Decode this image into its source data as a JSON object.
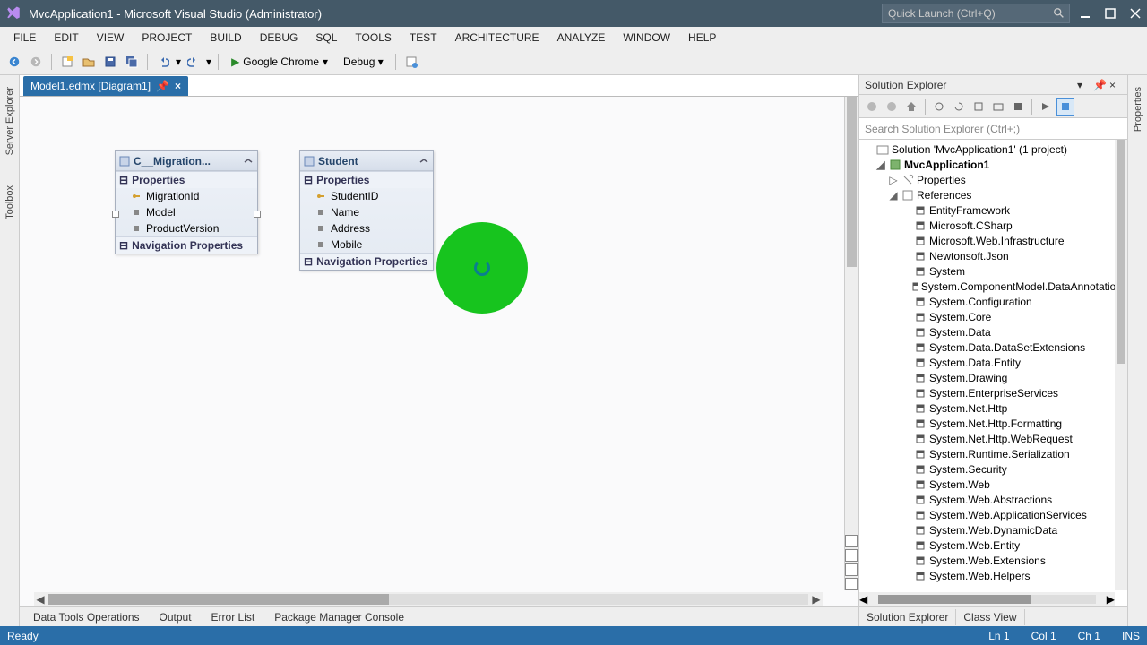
{
  "title": "MvcApplication1 - Microsoft Visual Studio (Administrator)",
  "quickLaunch": {
    "placeholder": "Quick Launch (Ctrl+Q)"
  },
  "menu": [
    "FILE",
    "EDIT",
    "VIEW",
    "PROJECT",
    "BUILD",
    "DEBUG",
    "SQL",
    "TOOLS",
    "TEST",
    "ARCHITECTURE",
    "ANALYZE",
    "WINDOW",
    "HELP"
  ],
  "toolbar": {
    "browser": "Google Chrome",
    "config": "Debug"
  },
  "leftVTabs": [
    "Server Explorer",
    "Toolbox"
  ],
  "rightVTabs": [
    "Properties"
  ],
  "docTab": {
    "label": "Model1.edmx [Diagram1]"
  },
  "entities": [
    {
      "name": "C__Migration...",
      "propsHeader": "Properties",
      "navHeader": "Navigation Properties",
      "props": [
        "MigrationId",
        "Model",
        "ProductVersion"
      ]
    },
    {
      "name": "Student",
      "propsHeader": "Properties",
      "navHeader": "Navigation Properties",
      "props": [
        "StudentID",
        "Name",
        "Address",
        "Mobile"
      ]
    }
  ],
  "bottomTabs": [
    "Data Tools Operations",
    "Output",
    "Error List",
    "Package Manager Console"
  ],
  "solExplorer": {
    "title": "Solution Explorer",
    "searchPlaceholder": "Search Solution Explorer (Ctrl+;)",
    "solution": "Solution 'MvcApplication1' (1 project)",
    "project": "MvcApplication1",
    "nodes": {
      "properties": "Properties",
      "references": "References"
    },
    "refs": [
      "EntityFramework",
      "Microsoft.CSharp",
      "Microsoft.Web.Infrastructure",
      "Newtonsoft.Json",
      "System",
      "System.ComponentModel.DataAnnotations",
      "System.Configuration",
      "System.Core",
      "System.Data",
      "System.Data.DataSetExtensions",
      "System.Data.Entity",
      "System.Drawing",
      "System.EnterpriseServices",
      "System.Net.Http",
      "System.Net.Http.Formatting",
      "System.Net.Http.WebRequest",
      "System.Runtime.Serialization",
      "System.Security",
      "System.Web",
      "System.Web.Abstractions",
      "System.Web.ApplicationServices",
      "System.Web.DynamicData",
      "System.Web.Entity",
      "System.Web.Extensions",
      "System.Web.Helpers"
    ],
    "bottomTabs": [
      "Solution Explorer",
      "Class View"
    ]
  },
  "status": {
    "ready": "Ready",
    "ln": "Ln 1",
    "col": "Col 1",
    "ch": "Ch 1",
    "ins": "INS"
  }
}
